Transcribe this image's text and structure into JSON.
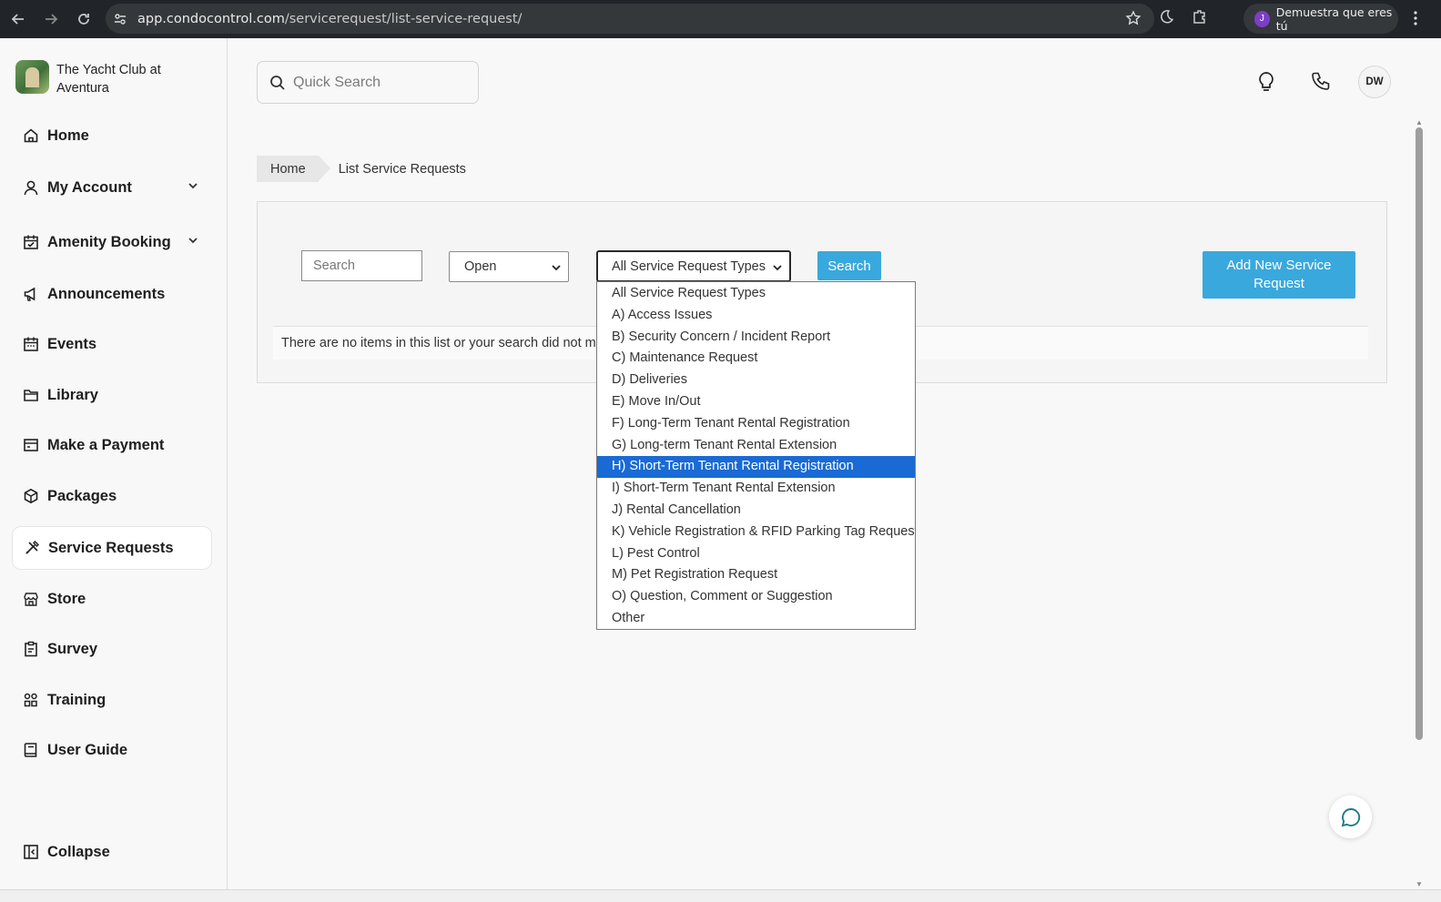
{
  "browser": {
    "url_host": "app.condocontrol.com",
    "url_path": "/servicerequest/list-service-request/",
    "profile_initial": "J",
    "profile_label": "Demuestra que eres tú"
  },
  "sidebar": {
    "brand_name": "The Yacht Club at Aventura",
    "items": [
      {
        "label": "Home",
        "icon": "home-icon"
      },
      {
        "label": "My Account",
        "icon": "user-icon"
      },
      {
        "label": "Amenity Booking",
        "icon": "calendar-check-icon"
      },
      {
        "label": "Announcements",
        "icon": "megaphone-icon"
      },
      {
        "label": "Events",
        "icon": "calendar-icon"
      },
      {
        "label": "Library",
        "icon": "folder-icon"
      },
      {
        "label": "Make a Payment",
        "icon": "card-icon"
      },
      {
        "label": "Packages",
        "icon": "package-icon"
      },
      {
        "label": "Service Requests",
        "icon": "tools-icon"
      },
      {
        "label": "Store",
        "icon": "store-icon"
      },
      {
        "label": "Survey",
        "icon": "clipboard-icon"
      },
      {
        "label": "Training",
        "icon": "people-icon"
      },
      {
        "label": "User Guide",
        "icon": "book-icon"
      }
    ],
    "collapse_label": "Collapse"
  },
  "header": {
    "quick_search_placeholder": "Quick Search",
    "avatar_initials": "DW"
  },
  "breadcrumb": {
    "home": "Home",
    "current": "List Service Requests"
  },
  "filters": {
    "search_placeholder": "Search",
    "status_value": "Open",
    "type_value": "All Service Request Types",
    "search_button": "Search",
    "add_button": "Add New Service Request"
  },
  "empty_message": "There are no items in this list or your search did not ma",
  "type_options": [
    "All Service Request Types",
    "A) Access Issues",
    "B) Security Concern / Incident Report",
    "C) Maintenance Request",
    "D) Deliveries",
    "E) Move In/Out",
    "F) Long-Term Tenant Rental Registration",
    "G) Long-term Tenant Rental Extension",
    "H) Short-Term Tenant Rental Registration",
    "I) Short-Term Tenant Rental Extension",
    "J) Rental Cancellation",
    "K) Vehicle Registration & RFID Parking Tag Request",
    "L) Pest Control",
    "M) Pet Registration Request",
    "O) Question, Comment or Suggestion",
    "Other"
  ],
  "highlighted_option": "H) Short-Term Tenant Rental Registration",
  "colors": {
    "accent": "#39a8dd",
    "highlight": "#1a6ad5",
    "chrome": "#212529"
  }
}
